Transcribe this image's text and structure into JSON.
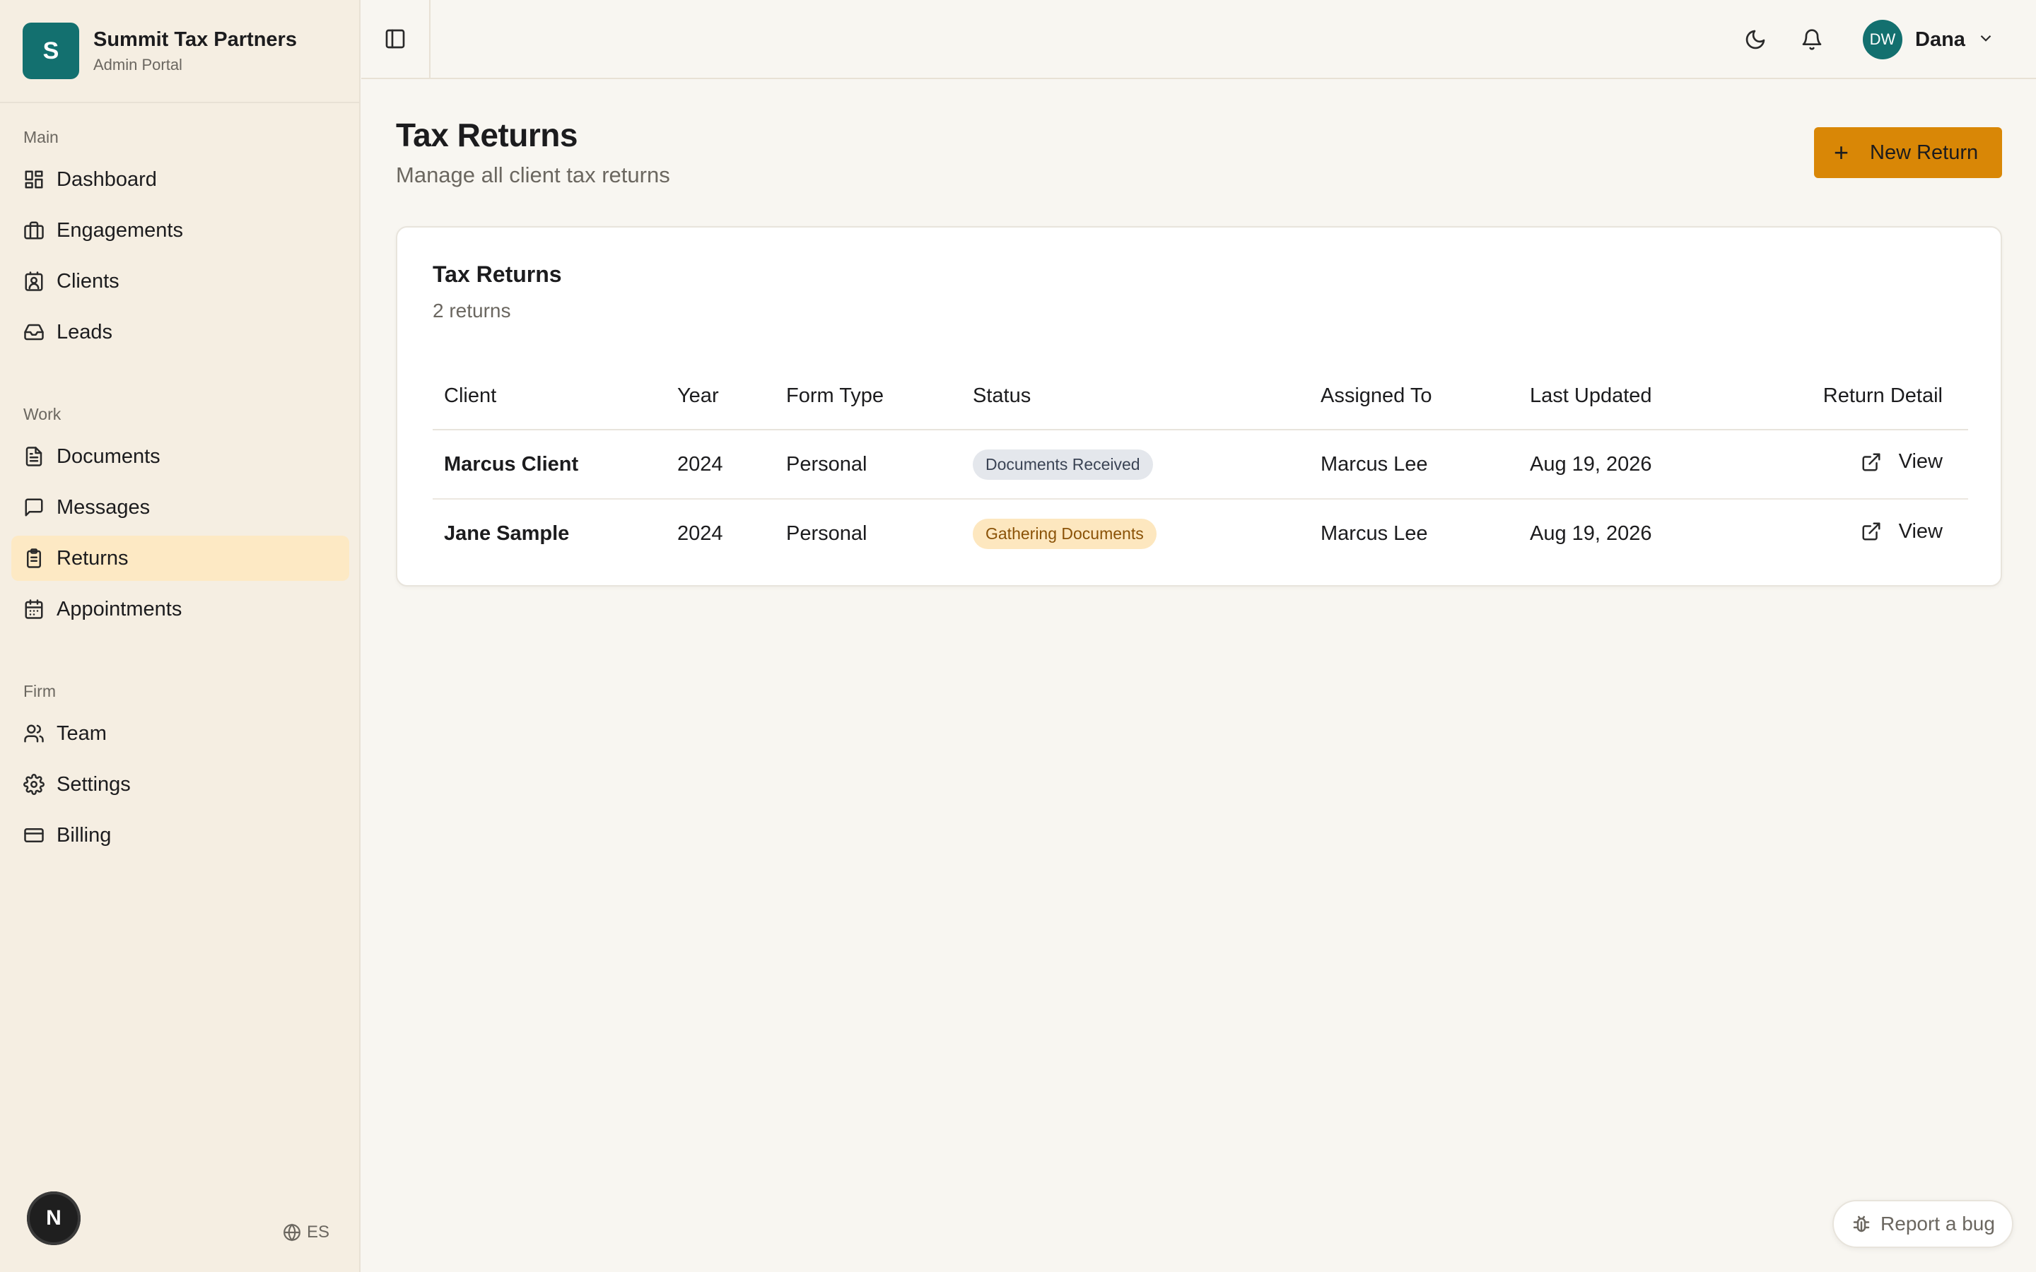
{
  "brand": {
    "initial": "S",
    "name": "Summit Tax Partners",
    "subtitle": "Admin Portal"
  },
  "sidebar": {
    "sections": [
      {
        "label": "Main",
        "items": [
          {
            "label": "Dashboard",
            "icon": "dashboard-icon"
          },
          {
            "label": "Engagements",
            "icon": "briefcase-icon"
          },
          {
            "label": "Clients",
            "icon": "contact-icon"
          },
          {
            "label": "Leads",
            "icon": "inbox-icon"
          }
        ]
      },
      {
        "label": "Work",
        "items": [
          {
            "label": "Documents",
            "icon": "document-icon"
          },
          {
            "label": "Messages",
            "icon": "message-icon"
          },
          {
            "label": "Returns",
            "icon": "clipboard-icon",
            "active": true
          },
          {
            "label": "Appointments",
            "icon": "calendar-icon"
          }
        ]
      },
      {
        "label": "Firm",
        "items": [
          {
            "label": "Team",
            "icon": "users-icon"
          },
          {
            "label": "Settings",
            "icon": "gear-icon"
          },
          {
            "label": "Billing",
            "icon": "credit-card-icon"
          }
        ]
      }
    ],
    "n_badge": "N",
    "language": "ES"
  },
  "topbar": {
    "user_initials": "DW",
    "user_name": "Dana"
  },
  "page": {
    "title": "Tax Returns",
    "subtitle": "Manage all client tax returns",
    "new_button": "New Return"
  },
  "card": {
    "title": "Tax Returns",
    "count": "2 returns",
    "columns": [
      "Client",
      "Year",
      "Form Type",
      "Status",
      "Assigned To",
      "Last Updated",
      "Return Detail"
    ],
    "rows": [
      {
        "client": "Marcus Client",
        "year": "2024",
        "form_type": "Personal",
        "status": "Documents Received",
        "assigned_to": "Marcus Lee",
        "last_updated": "Aug 19, 2026",
        "action": "View"
      },
      {
        "client": "Jane Sample",
        "year": "2024",
        "form_type": "Personal",
        "status": "Gathering Documents",
        "assigned_to": "Marcus Lee",
        "last_updated": "Aug 19, 2026",
        "action": "View"
      }
    ]
  },
  "report_bug": "Report a bug",
  "colors": {
    "accent": "#d98706",
    "brand": "#13706f",
    "active_nav": "#fde9c4"
  }
}
